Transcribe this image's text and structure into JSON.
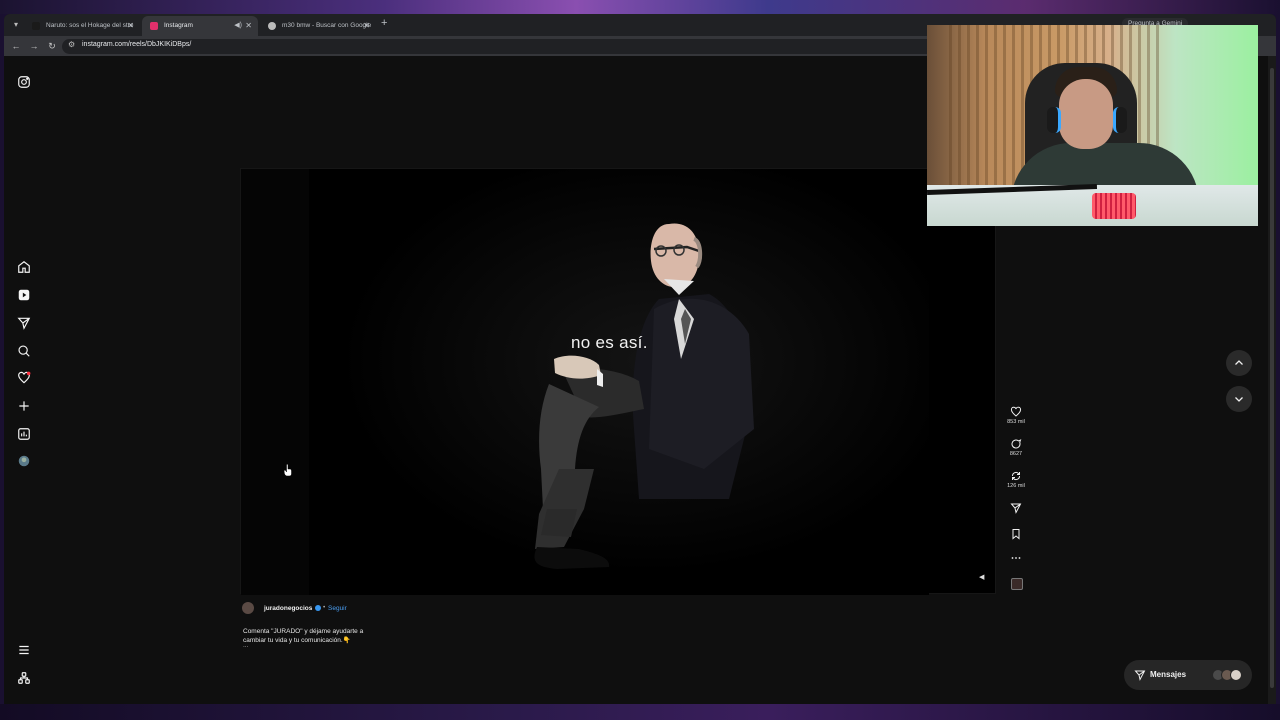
{
  "browser": {
    "tabs": [
      {
        "label": "Naruto: sos el Hokage del stre",
        "active": false,
        "favicon_color": "#e8e8e8"
      },
      {
        "label": "Instagram",
        "active": true,
        "favicon_color": "#e1306c"
      },
      {
        "label": "m30 bmw - Buscar con Google",
        "active": false,
        "favicon_color": "#bbbbbb"
      }
    ],
    "new_tab_label": "+",
    "gemini_label": "Pregunta a Gemini",
    "url": "instagram.com/reels/DbJKIKiDBps/"
  },
  "instagram": {
    "nav_icons": [
      "instagram-logo-icon",
      "home-icon",
      "reels-icon",
      "direct-send-icon",
      "search-icon",
      "notifications-heart-icon",
      "create-plus-icon",
      "dashboard-icon",
      "profile-avatar-icon",
      "menu-icon",
      "threads-icon"
    ],
    "reel": {
      "subtitle": "no es así.",
      "author": "juradonegocios",
      "separator": "•",
      "follow_label": "Seguir",
      "caption": "Comenta \"JURADO\" y déjame ayudarte a cambiar tu vida y tu comunicación.👇",
      "more": "..."
    },
    "actions": {
      "likes": "853 mil",
      "comments": "8627",
      "reposts": "126 mil"
    },
    "messages_label": "Mensajes"
  },
  "colors": {
    "accent_blue": "#4a9df0",
    "page_bg": "#0f0f0f",
    "notification_dot": "#ff3040"
  }
}
